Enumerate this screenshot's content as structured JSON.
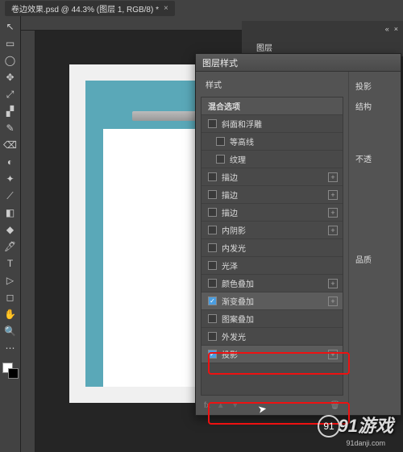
{
  "tab": {
    "title": "卷边效果.psd @ 44.3% (图层 1, RGB/8) *",
    "close": "×"
  },
  "panel": {
    "collapse_left": "«",
    "collapse_right": "×",
    "tab": "图层"
  },
  "dialog": {
    "title": "图层样式",
    "styles_header": "样式",
    "blend_options": "混合选项",
    "right": {
      "title": "投影",
      "structure": "结构",
      "opacity": "不透",
      "quality": "品质"
    },
    "items": [
      {
        "label": "斜面和浮雕",
        "checkbox": true,
        "checked": false,
        "plus": false
      },
      {
        "label": "等高线",
        "checkbox": true,
        "checked": false,
        "plus": false,
        "indent": true
      },
      {
        "label": "纹理",
        "checkbox": true,
        "checked": false,
        "plus": false,
        "indent": true
      },
      {
        "label": "描边",
        "checkbox": true,
        "checked": false,
        "plus": true
      },
      {
        "label": "描边",
        "checkbox": true,
        "checked": false,
        "plus": true
      },
      {
        "label": "描边",
        "checkbox": true,
        "checked": false,
        "plus": true
      },
      {
        "label": "内阴影",
        "checkbox": true,
        "checked": false,
        "plus": true
      },
      {
        "label": "内发光",
        "checkbox": true,
        "checked": false,
        "plus": false
      },
      {
        "label": "光泽",
        "checkbox": true,
        "checked": false,
        "plus": false
      },
      {
        "label": "颜色叠加",
        "checkbox": true,
        "checked": false,
        "plus": true
      },
      {
        "label": "渐变叠加",
        "checkbox": true,
        "checked": true,
        "plus": true,
        "selected": true
      },
      {
        "label": "图案叠加",
        "checkbox": true,
        "checked": false,
        "plus": false
      },
      {
        "label": "外发光",
        "checkbox": true,
        "checked": false,
        "plus": false
      },
      {
        "label": "投影",
        "checkbox": true,
        "checked": true,
        "plus": true,
        "selected": true
      }
    ],
    "footer": {
      "fx": "fx",
      "up": "▲",
      "down": "▼",
      "trash": "🗑"
    }
  },
  "watermark": {
    "brand": "91游戏",
    "url": "91danji.com",
    "icon": "91"
  },
  "tools": [
    "↖",
    "▭",
    "◯",
    "✥",
    "⤢",
    "▞",
    "✎",
    "⌫",
    "◐",
    "✦",
    "⟋",
    "◧",
    "◆",
    "🖋",
    "T",
    "▷",
    "◻",
    "✋",
    "🔍",
    "⋯"
  ]
}
